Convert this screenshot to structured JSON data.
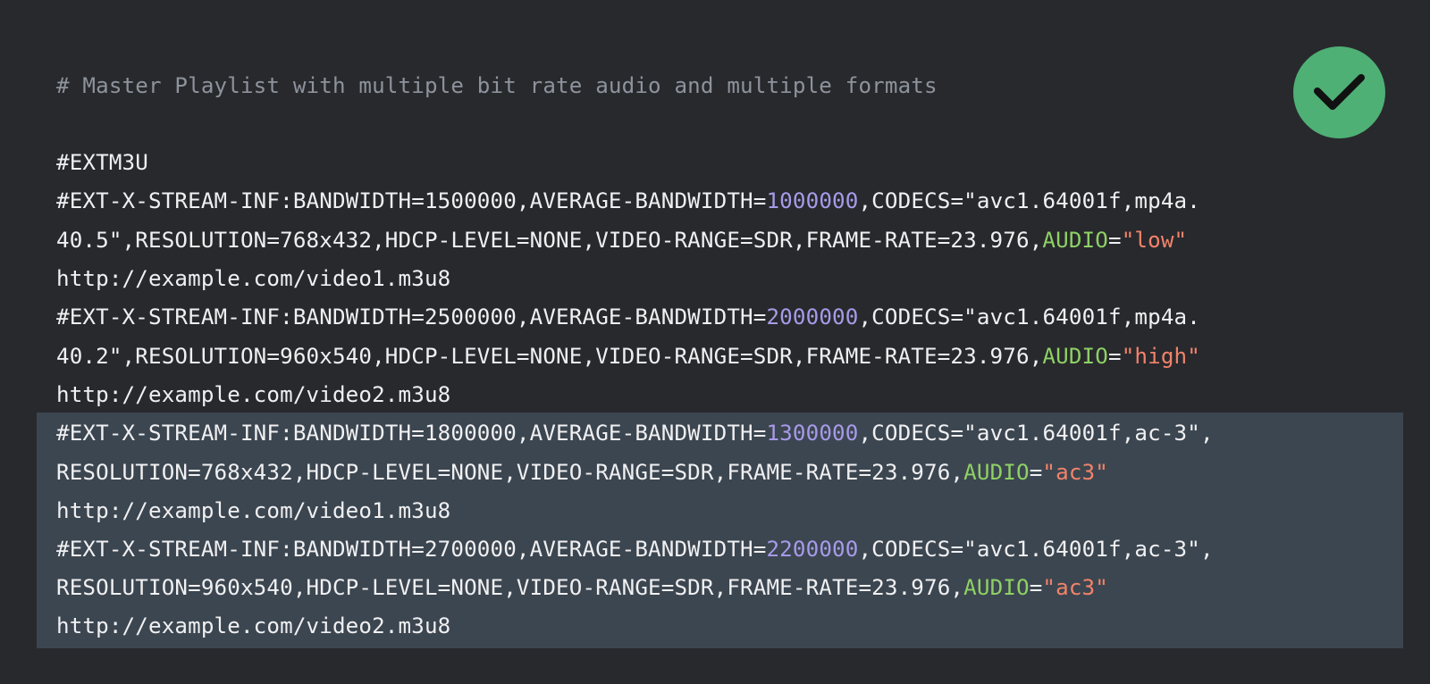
{
  "colors": {
    "background": "#28292d",
    "highlight": "#3c4650",
    "text": "#f0f0f2",
    "comment": "#8d939c",
    "number": "#a79ae8",
    "attribute": "#8ed165",
    "string": "#f2836b",
    "badge": "#4eb075",
    "check": "#111111"
  },
  "icons": {
    "badge": "check-icon"
  },
  "code": {
    "comment": "# Master Playlist with multiple bit rate audio and multiple formats",
    "header": "#EXTM3U",
    "stream_1_line_1_prefix": "#EXT-X-STREAM-INF:BANDWIDTH=1500000,AVERAGE-BANDWIDTH=",
    "stream_1_avg": "1000000",
    "stream_1_line_1_suffix": ",CODECS=\"avc1.64001f,mp4a.",
    "stream_1_line_2_prefix": "40.5\",RESOLUTION=768x432,HDCP-LEVEL=NONE,VIDEO-RANGE=SDR,FRAME-RATE=23.976,",
    "stream_1_audio_key": "AUDIO",
    "stream_1_equals": "=",
    "stream_1_audio_value": "\"low\"",
    "stream_1_url": "http://example.com/video1.m3u8",
    "stream_2_line_1_prefix": "#EXT-X-STREAM-INF:BANDWIDTH=2500000,AVERAGE-BANDWIDTH=",
    "stream_2_avg": "2000000",
    "stream_2_line_1_suffix": ",CODECS=\"avc1.64001f,mp4a.",
    "stream_2_line_2_prefix": "40.2\",RESOLUTION=960x540,HDCP-LEVEL=NONE,VIDEO-RANGE=SDR,FRAME-RATE=23.976,",
    "stream_2_audio_key": "AUDIO",
    "stream_2_equals": "=",
    "stream_2_audio_value": "\"high\"",
    "stream_2_url": "http://example.com/video2.m3u8",
    "stream_3_line_1_prefix": "#EXT-X-STREAM-INF:BANDWIDTH=1800000,AVERAGE-BANDWIDTH=",
    "stream_3_avg": "1300000",
    "stream_3_line_1_suffix": ",CODECS=\"avc1.64001f,ac-3\",",
    "stream_3_line_2_prefix": "RESOLUTION=768x432,HDCP-LEVEL=NONE,VIDEO-RANGE=SDR,FRAME-RATE=23.976,",
    "stream_3_audio_key": "AUDIO",
    "stream_3_equals": "=",
    "stream_3_audio_value": "\"ac3\"",
    "stream_3_url": "http://example.com/video1.m3u8",
    "stream_4_line_1_prefix": "#EXT-X-STREAM-INF:BANDWIDTH=2700000,AVERAGE-BANDWIDTH=",
    "stream_4_avg": "2200000",
    "stream_4_line_1_suffix": ",CODECS=\"avc1.64001f,ac-3\",",
    "stream_4_line_2_prefix": "RESOLUTION=960x540,HDCP-LEVEL=NONE,VIDEO-RANGE=SDR,FRAME-RATE=23.976,",
    "stream_4_audio_key": "AUDIO",
    "stream_4_equals": "=",
    "stream_4_audio_value": "\"ac3\"",
    "stream_4_url": "http://example.com/video2.m3u8"
  }
}
